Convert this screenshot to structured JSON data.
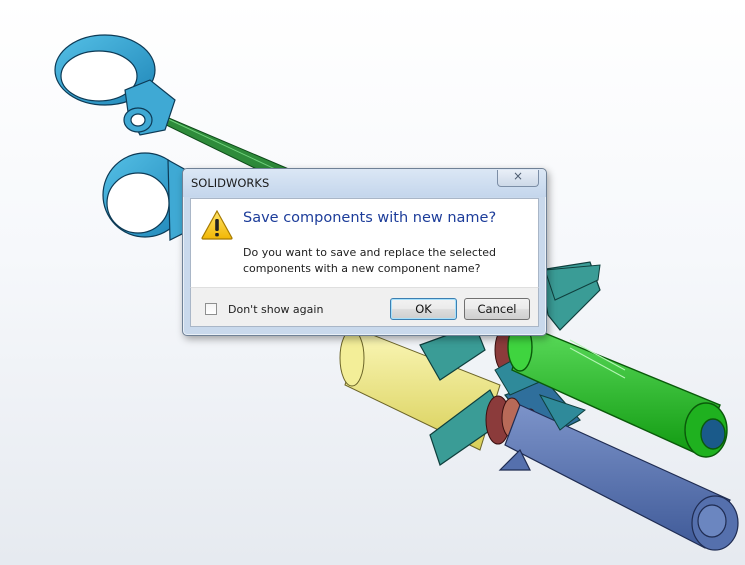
{
  "dialog": {
    "title": "SOLIDWORKS",
    "close_symbol": "×",
    "icon": "warning-icon",
    "main_instruction": "Save components with new name?",
    "body": "Do you want to save and replace the selected components with a new component name?",
    "checkbox_label": "Don't show again",
    "checkbox_checked": false,
    "ok_label": "OK",
    "cancel_label": "Cancel"
  },
  "colors": {
    "component_cyan": "#3fa9d4",
    "selected_green": "#22c422",
    "shaft_green": "#2e8b3a",
    "slate_blue": "#5570ad",
    "teal_plate": "#3a9c96",
    "yellow_body": "#f0ea82",
    "maroon_bushing": "#8b3b3b"
  }
}
